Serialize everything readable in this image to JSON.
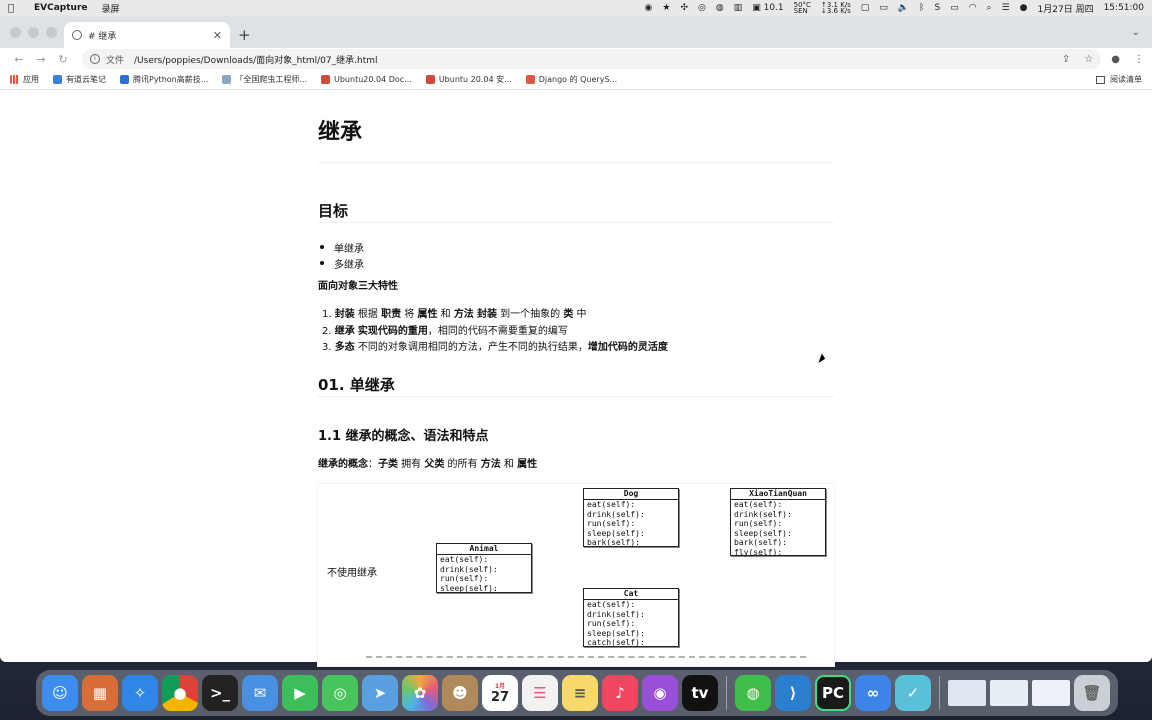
{
  "menubar": {
    "app_name": "EVCapture",
    "menu_item": "录屏",
    "temp": "50°C",
    "temp_sub": "SEN",
    "cpu": "10.1",
    "net_up": "3.1",
    "net_down": "3.6",
    "net_unit": "K/s",
    "date": "1月27日 周四",
    "time": "15:51:00"
  },
  "browser": {
    "tab_title": "# 继承",
    "url_scheme": "文件",
    "url_path": "/Users/poppies/Downloads/面向对象_html/07_继承.html",
    "bookmarks": [
      {
        "label": "应用",
        "color": "#e25c3c"
      },
      {
        "label": "有道云笔记",
        "color": "#3a7de0"
      },
      {
        "label": "腾讯Python高薪技...",
        "color": "#2b6fd6"
      },
      {
        "label": "「全国爬虫工程师...",
        "color": "#8aa7c7"
      },
      {
        "label": "Ubuntu20.04 Doc...",
        "color": "#d24b3a"
      },
      {
        "label": "Ubuntu 20.04 安...",
        "color": "#d24b3a"
      },
      {
        "label": "Django 的 QueryS...",
        "color": "#e0583f"
      }
    ],
    "reading_list": "阅读清单"
  },
  "page": {
    "h1": "继承",
    "h2_goal": "目标",
    "goal_items": [
      "单继承",
      "多继承"
    ],
    "oo_title": "面向对象三大特性",
    "feature1": {
      "b1": "封装",
      "t1": " 根据 ",
      "b2": "职责",
      "t2": " 将 ",
      "b3": "属性",
      "t3": " 和 ",
      "b4": "方法",
      "t4": " ",
      "b5": "封装",
      "t5": " 到一个抽象的 ",
      "b6": "类",
      "t6": " 中"
    },
    "feature2": {
      "b1": "继承",
      "t1": " ",
      "b2": "实现代码的重用",
      "t2": "，相同的代码不需要重复的编写"
    },
    "feature3": {
      "b1": "多态",
      "t1": " 不同的对象调用相同的方法，产生不同的执行结果，",
      "b2": "增加代码的灵活度"
    },
    "h2_single": "01. 单继承",
    "h3_concept": "1.1 继承的概念、语法和特点",
    "concept": {
      "b1": "继承的概念",
      "t1": "：",
      "b2": "子类",
      "t2": " 拥有 ",
      "b3": "父类",
      "t3": " 的所有 ",
      "b4": "方法",
      "t4": " 和 ",
      "b5": "属性"
    },
    "diagram_label": "不使用继承",
    "classes": {
      "animal": {
        "name": "Animal",
        "methods": [
          "eat(self):",
          "drink(self):",
          "run(self):",
          "sleep(self):"
        ]
      },
      "dog": {
        "name": "Dog",
        "methods": [
          "eat(self):",
          "drink(self):",
          "run(self):",
          "sleep(self):",
          "bark(self):"
        ]
      },
      "cat": {
        "name": "Cat",
        "methods": [
          "eat(self):",
          "drink(self):",
          "run(self):",
          "sleep(self):",
          "catch(self):"
        ]
      },
      "xtq": {
        "name": "XiaoTianQuan",
        "methods": [
          "eat(self):",
          "drink(self):",
          "run(self):",
          "sleep(self):",
          "bark(self):",
          "fly(self):"
        ]
      }
    }
  },
  "dock": {
    "calendar_month": "1月",
    "calendar_day": "27",
    "apps": [
      {
        "name": "finder",
        "color": "#3d8df0"
      },
      {
        "name": "launchpad",
        "color": "#d96d3a"
      },
      {
        "name": "safari",
        "color": "#2f86e8"
      },
      {
        "name": "chrome",
        "color": "#e0b23a"
      },
      {
        "name": "terminal",
        "color": "#222222"
      },
      {
        "name": "mail",
        "color": "#4a90e2"
      },
      {
        "name": "facetime",
        "color": "#3cbf5a"
      },
      {
        "name": "messages",
        "color": "#47c55c"
      },
      {
        "name": "maps",
        "color": "#5aa0e0"
      },
      {
        "name": "photos",
        "color": "#e6a0c0"
      },
      {
        "name": "contacts",
        "color": "#b08a5a"
      },
      {
        "name": "calendar",
        "color": "#ffffff"
      },
      {
        "name": "reminders",
        "color": "#f2f2f2"
      },
      {
        "name": "notes",
        "color": "#f7d96a"
      },
      {
        "name": "music",
        "color": "#f24660"
      },
      {
        "name": "podcasts",
        "color": "#9a4fd8"
      },
      {
        "name": "tv",
        "color": "#111111"
      },
      {
        "name": "wechat",
        "color": "#3fbf4a"
      },
      {
        "name": "vscode",
        "color": "#2a7fd0"
      },
      {
        "name": "pycharm",
        "color": "#1a1a1a"
      },
      {
        "name": "baidu-netdisk",
        "color": "#3e84e8"
      },
      {
        "name": "other-app",
        "color": "#5ac0d8"
      }
    ]
  }
}
